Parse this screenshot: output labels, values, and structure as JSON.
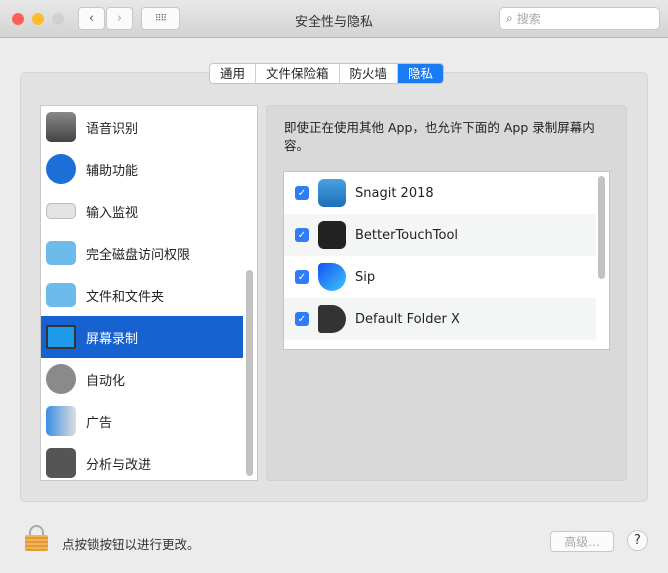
{
  "window": {
    "title": "安全性与隐私",
    "search_placeholder": "搜索"
  },
  "tabs": [
    {
      "label": "通用"
    },
    {
      "label": "文件保险箱"
    },
    {
      "label": "防火墙"
    },
    {
      "label": "隐私",
      "selected": true
    }
  ],
  "sidebar": {
    "items": [
      {
        "label": "语音识别",
        "icon": "speech-recognition-icon"
      },
      {
        "label": "辅助功能",
        "icon": "accessibility-icon"
      },
      {
        "label": "输入监视",
        "icon": "keyboard-icon"
      },
      {
        "label": "完全磁盘访问权限",
        "icon": "folder-icon"
      },
      {
        "label": "文件和文件夹",
        "icon": "folder-icon"
      },
      {
        "label": "屏幕录制",
        "icon": "display-icon",
        "selected": true
      },
      {
        "label": "自动化",
        "icon": "gear-icon"
      },
      {
        "label": "广告",
        "icon": "megaphone-icon"
      },
      {
        "label": "分析与改进",
        "icon": "analytics-icon"
      }
    ]
  },
  "main": {
    "description": "即使正在使用其他 App，也允许下面的 App 录制屏幕内容。",
    "apps": [
      {
        "name": "Snagit 2018",
        "checked": true
      },
      {
        "name": "BetterTouchTool",
        "checked": true
      },
      {
        "name": "Sip",
        "checked": true
      },
      {
        "name": "Default Folder X",
        "checked": true
      }
    ]
  },
  "footer": {
    "lock_text": "点按锁按钮以进行更改。",
    "advanced_label": "高级...",
    "help_label": "?"
  }
}
